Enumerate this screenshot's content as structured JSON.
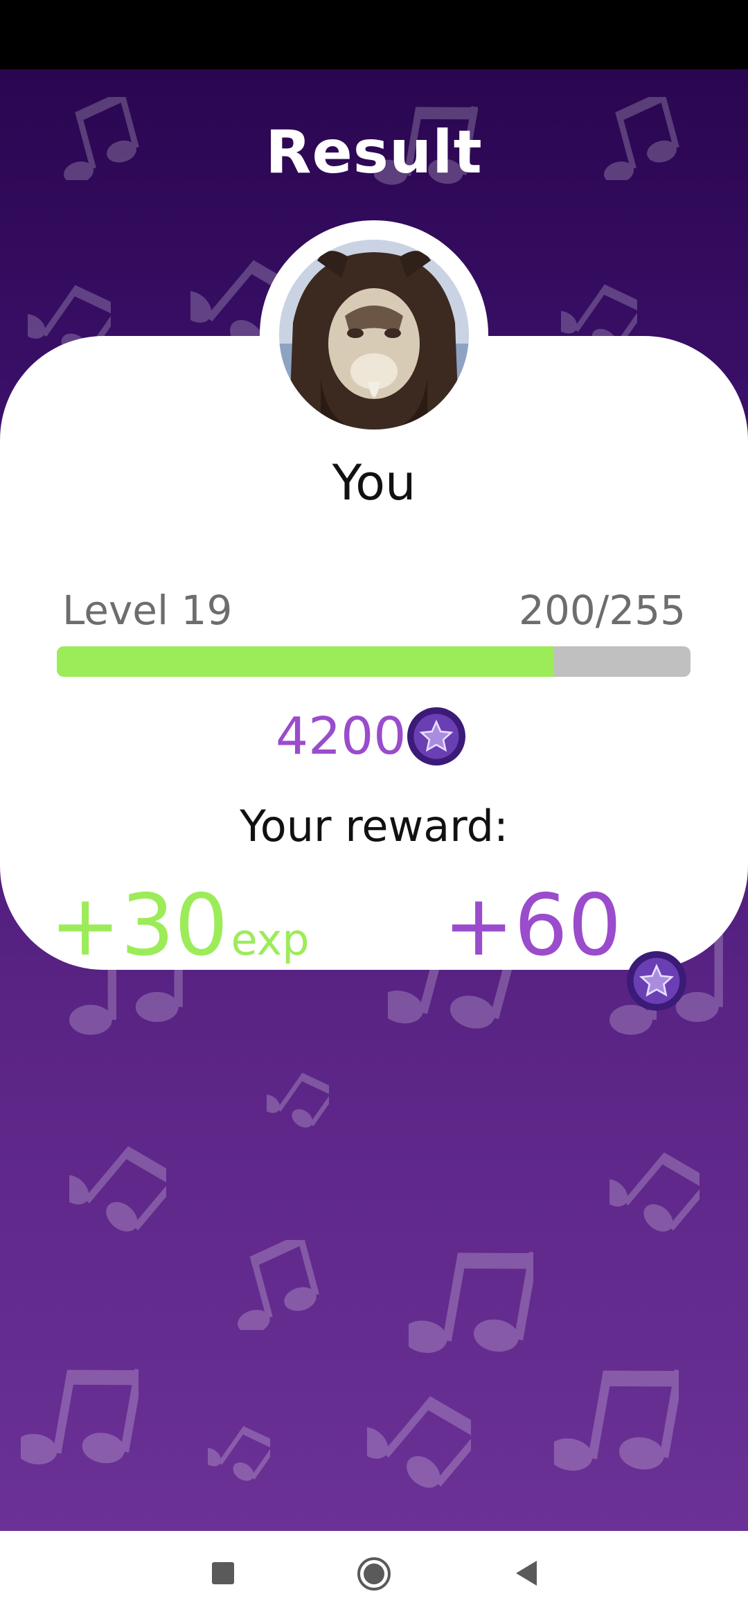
{
  "header": {
    "title": "Result"
  },
  "player": {
    "name": "You",
    "avatar": "player-avatar-photo"
  },
  "level": {
    "label": "Level 19",
    "progress_text": "200/255",
    "progress_fraction": 0.7843
  },
  "coins": {
    "total": "4200",
    "icon": "star-coin-icon"
  },
  "reward": {
    "label": "Your reward:",
    "exp_value": "+30",
    "exp_unit": "exp",
    "coin_value": "+60"
  },
  "colors": {
    "accent_green": "#9cec5a",
    "accent_purple": "#9a4ccc",
    "background_top": "#2a0650",
    "background_bottom": "#6b3196"
  },
  "nav": {
    "recents_icon": "square-icon",
    "home_icon": "circle-icon",
    "back_icon": "triangle-back-icon"
  }
}
